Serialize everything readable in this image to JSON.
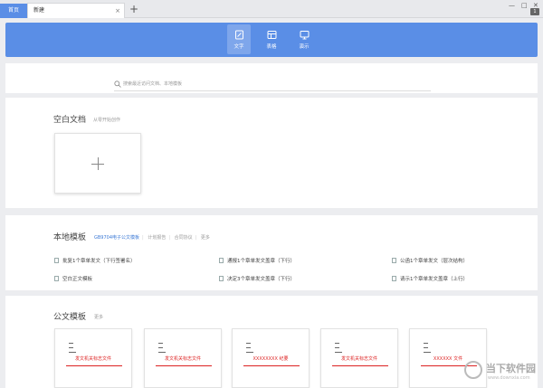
{
  "tabs": {
    "home": "首页",
    "current": "新建",
    "close": "×",
    "add": "+"
  },
  "window": {
    "minimize": "—",
    "maximize": "□",
    "close": "✕",
    "badge": "1"
  },
  "header": {
    "tabs": [
      {
        "label": "文字",
        "icon": "document-icon",
        "active": true
      },
      {
        "label": "表格",
        "icon": "spreadsheet-icon",
        "active": false
      },
      {
        "label": "演示",
        "icon": "presentation-icon",
        "active": false
      }
    ]
  },
  "search": {
    "placeholder": "搜索最近访问文档、本地模板"
  },
  "blank": {
    "title": "空白文档",
    "subtitle": "从零开始创作"
  },
  "local": {
    "title": "本地模板",
    "links": [
      "GB9704电子公文模板",
      "计划报告",
      "合同协议",
      "更多"
    ],
    "templates": [
      "批复1个章单发文（下行签署名）",
      "通报1个章单发文盖章（下行）",
      "公函1个章单发文（层次结构）",
      "空白正文模板",
      "决定3个章单发文盖章（下行）",
      "请示1个章单发文盖章（上行）"
    ]
  },
  "official": {
    "title": "公文模板",
    "more": "更多",
    "thumbs": [
      "发文机关标志文件",
      "发文机关标志文件",
      "XXXXXXXX 纪要",
      "发文机关标志文件",
      "XXXXXX 文件"
    ]
  },
  "watermark": {
    "text": "当下软件园",
    "url": "www.downxia.com"
  },
  "colors": {
    "accent": "#5a8ee6",
    "red": "#d22222",
    "link": "#3d7ad6"
  }
}
